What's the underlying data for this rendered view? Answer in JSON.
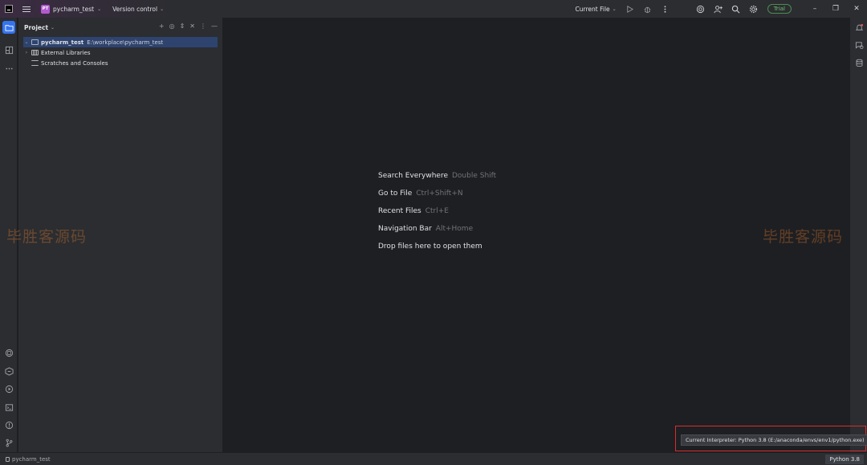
{
  "titlebar": {
    "project_badge": "PT",
    "project_name": "pycharm_test",
    "vcs_label": "Version control",
    "run_config": "Current File",
    "trial_label": "Trial"
  },
  "project_panel": {
    "title": "Project",
    "root": {
      "name": "pycharm_test",
      "path": "E:\\workplace\\pycharm_test"
    },
    "items": [
      {
        "label": "External Libraries"
      },
      {
        "label": "Scratches and Consoles"
      }
    ]
  },
  "editor": {
    "hints": [
      {
        "label": "Search Everywhere",
        "key": "Double Shift"
      },
      {
        "label": "Go to File",
        "key": "Ctrl+Shift+N"
      },
      {
        "label": "Recent Files",
        "key": "Ctrl+E"
      },
      {
        "label": "Navigation Bar",
        "key": "Alt+Home"
      },
      {
        "label": "Drop files here to open them",
        "key": ""
      }
    ]
  },
  "watermark": "毕胜客源码",
  "statusbar": {
    "breadcrumb": "pycharm_test",
    "interpreter": "Python 3.8"
  },
  "tooltip": {
    "text": "Current Interpreter: Python 3.8 (E:/anaconda/envs/env1/python.exe)"
  },
  "colors": {
    "accent": "#3574f0",
    "highlight_box": "#d72d2d",
    "trial": "#6fbf73",
    "project_badge": "#b25ad0"
  }
}
